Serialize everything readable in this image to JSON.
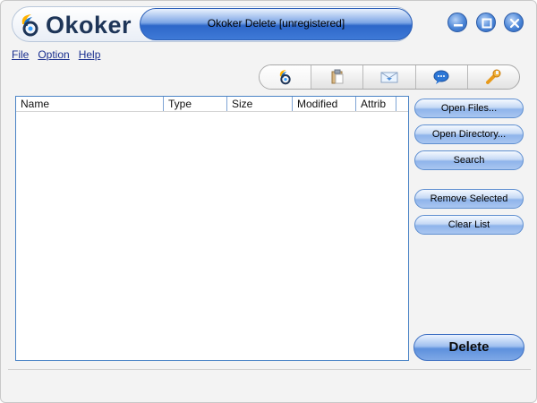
{
  "app": {
    "brand": "Okoker",
    "title": "Okoker Delete  [unregistered]"
  },
  "window_controls": [
    {
      "name": "minimize-button",
      "icon": "minimize-icon"
    },
    {
      "name": "maximize-button",
      "icon": "maximize-icon"
    },
    {
      "name": "close-button",
      "icon": "close-icon"
    }
  ],
  "menu": {
    "file": "File",
    "option": "Option",
    "help": "Help"
  },
  "toolbar_tabs": [
    {
      "icon": "okoker-logo-icon",
      "active": true
    },
    {
      "icon": "clipboard-icon"
    },
    {
      "icon": "envelope-icon"
    },
    {
      "icon": "chat-bubble-icon"
    },
    {
      "icon": "wrench-icon"
    }
  ],
  "list": {
    "columns": [
      "Name",
      "Type",
      "Size",
      "Modified",
      "Attrib"
    ],
    "rows": []
  },
  "buttons": {
    "open_files": "Open Files...",
    "open_directory": "Open Directory...",
    "search": "Search",
    "remove_selected": "Remove Selected",
    "clear_list": "Clear List",
    "delete": "Delete"
  },
  "colors": {
    "accent_blue": "#2d67c9",
    "list_border": "#4b84c6",
    "menu_text": "#1a2f8f"
  }
}
